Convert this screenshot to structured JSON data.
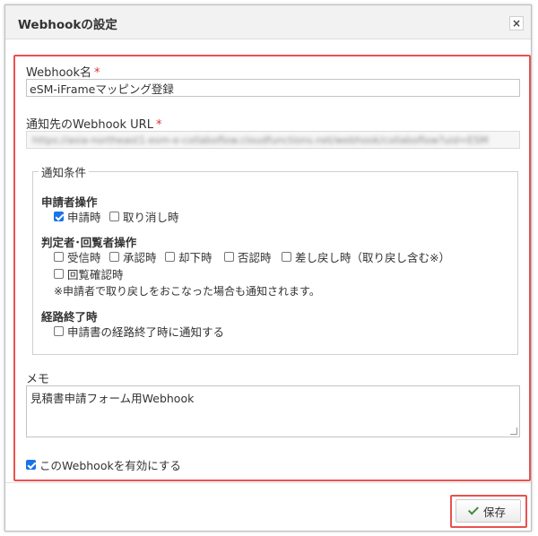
{
  "dialog": {
    "title": "Webhookの設定",
    "close_glyph": "×"
  },
  "form": {
    "name_label": "Webhook名",
    "required_mark": "*",
    "name_value": "eSM-iFrameマッピング登録",
    "url_label": "通知先のWebhook URL",
    "url_value_obscured": "https://asia-northeast1-esm-e-collaboflow.cloudfunctions.net/webhook/collaboflow?uid=ESM",
    "conditions": {
      "legend": "通知条件",
      "applicant": {
        "title": "申請者操作",
        "options": [
          {
            "label": "申請時",
            "checked": true
          },
          {
            "label": "取り消し時",
            "checked": false
          }
        ]
      },
      "approver": {
        "title": "判定者･回覧者操作",
        "options": [
          {
            "label": "受信時",
            "checked": false
          },
          {
            "label": "承認時",
            "checked": false
          },
          {
            "label": "却下時",
            "checked": false
          },
          {
            "label": "否認時",
            "checked": false
          },
          {
            "label": "差し戻し時（取り戻し含む※）",
            "checked": false
          },
          {
            "label": "回覧確認時",
            "checked": false
          }
        ],
        "note": "※申請者で取り戻しをおこなった場合も通知されます。"
      },
      "route_end": {
        "title": "経路終了時",
        "options": [
          {
            "label": "申請書の経路終了時に通知する",
            "checked": false
          }
        ]
      }
    },
    "memo_label": "メモ",
    "memo_value": "見積書申請フォーム用Webhook",
    "enable_label": "このWebhookを有効にする",
    "enable_checked": true
  },
  "footer": {
    "save_label": "保存",
    "save_icon": "check-icon"
  },
  "colors": {
    "highlight": "#e8534f",
    "checkbox_checked": "#1a73e8",
    "save_check": "#3c8c3c"
  }
}
